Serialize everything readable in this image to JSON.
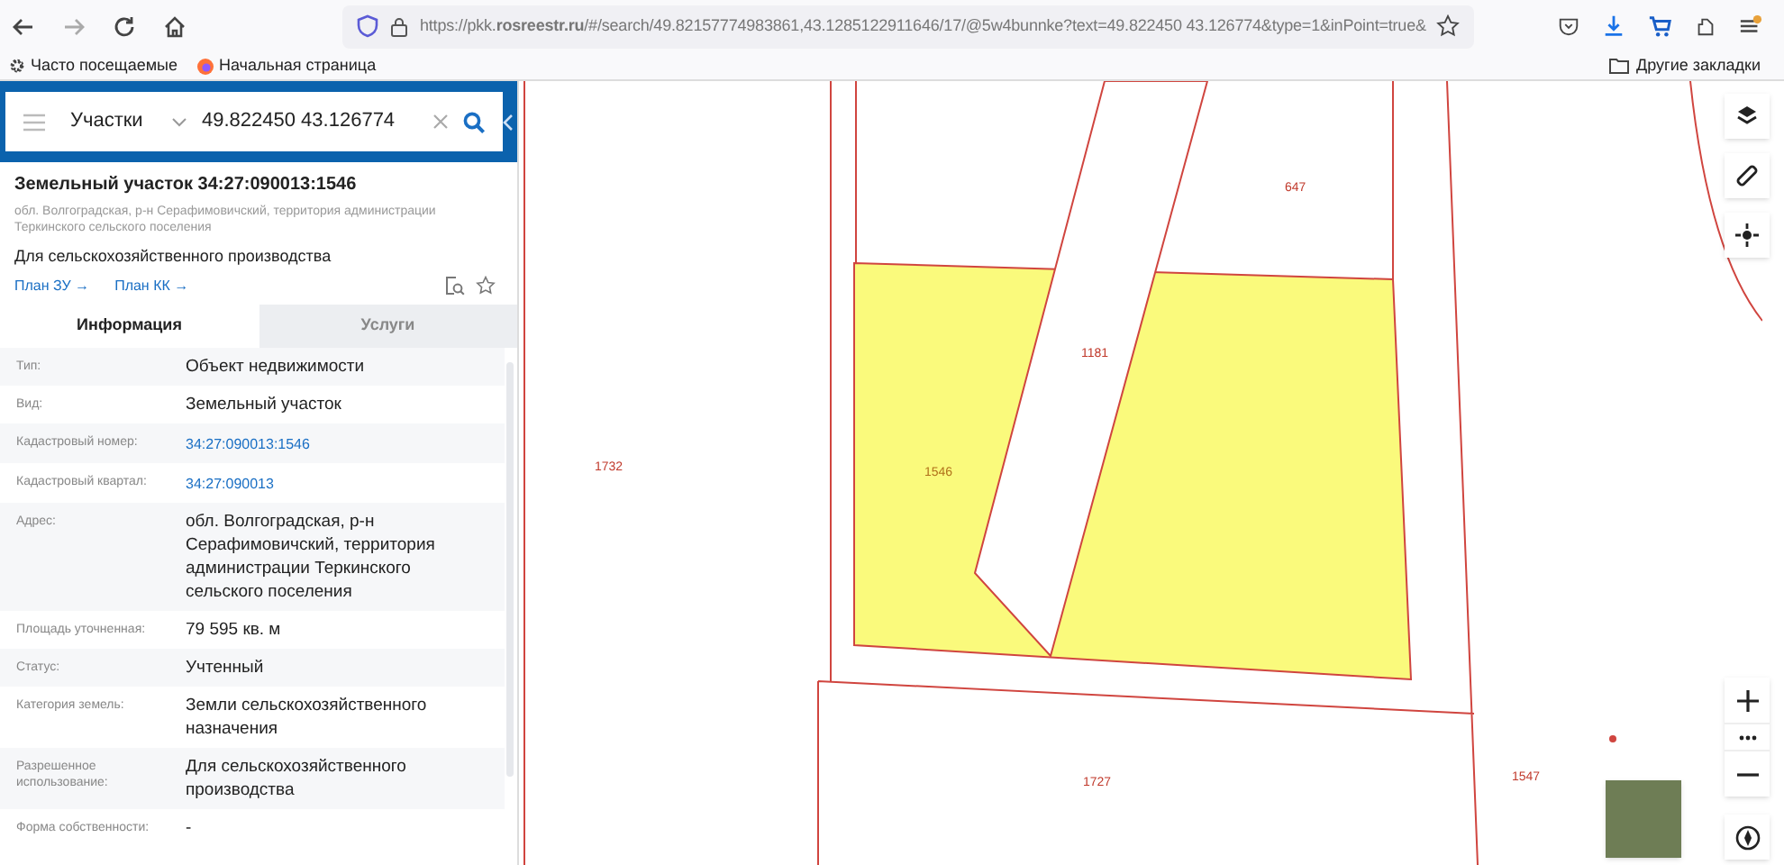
{
  "browser": {
    "url": "https://pkk.**rosreestr.ru**/#/search/49.82157774983861,43.1285122911646/17/@5w4bunnke?text=49.822450 43.126774&type=1&inPoint=true&",
    "bookmarks": [
      {
        "label": "Часто посещаемые",
        "kind": "gear"
      },
      {
        "label": "Начальная страница",
        "kind": "firefox"
      }
    ],
    "other_bookmarks": "Другие закладки"
  },
  "search": {
    "category": "Участки",
    "value": "49.822450 43.126774"
  },
  "card": {
    "title": "Земельный участок 34:27:090013:1546",
    "address": "обл. Волгоградская, р-н Серафимовичский, территория администрации Теркинского сельского поселения",
    "purpose": "Для сельскохозяйственного производства",
    "links": [
      "План ЗУ →",
      "План КК →"
    ]
  },
  "tabs": [
    {
      "label": "Информация",
      "selected": true
    },
    {
      "label": "Услуги",
      "selected": false
    }
  ],
  "rows": [
    {
      "label": "Тип:",
      "value": "Объект недвижимости",
      "kind": "text"
    },
    {
      "label": "Вид:",
      "value": "Земельный участок",
      "kind": "text"
    },
    {
      "label": "Кадастровый номер:",
      "value": "34:27:090013:1546",
      "kind": "link"
    },
    {
      "label": "Кадастровый квартал:",
      "value": "34:27:090013",
      "kind": "link"
    },
    {
      "label": "Адрес:",
      "value": "обл. Волгоградская, р-н Серафимовичский, территория администрации Теркинского сельского поселения",
      "kind": "text"
    },
    {
      "label": "Площадь уточненная:",
      "value": "79 595 кв. м",
      "kind": "text"
    },
    {
      "label": "Статус:",
      "value": "Учтенный",
      "kind": "text"
    },
    {
      "label": "Категория земель:",
      "value": "Земли сельскохозяйственного назначения",
      "kind": "text"
    },
    {
      "label": "Разрешенное использование:",
      "value": "Для сельскохозяйственного производства",
      "kind": "text"
    },
    {
      "label": "Форма собственности:",
      "value": "-",
      "kind": "text"
    }
  ],
  "map": {
    "parcel_labels": [
      {
        "label": "647",
        "selected": false
      },
      {
        "label": "1181",
        "selected": false
      },
      {
        "label": "1732",
        "selected": false
      },
      {
        "label": "1546",
        "selected": true
      },
      {
        "label": "1727",
        "selected": false
      },
      {
        "label": "1547",
        "selected": false
      }
    ]
  }
}
